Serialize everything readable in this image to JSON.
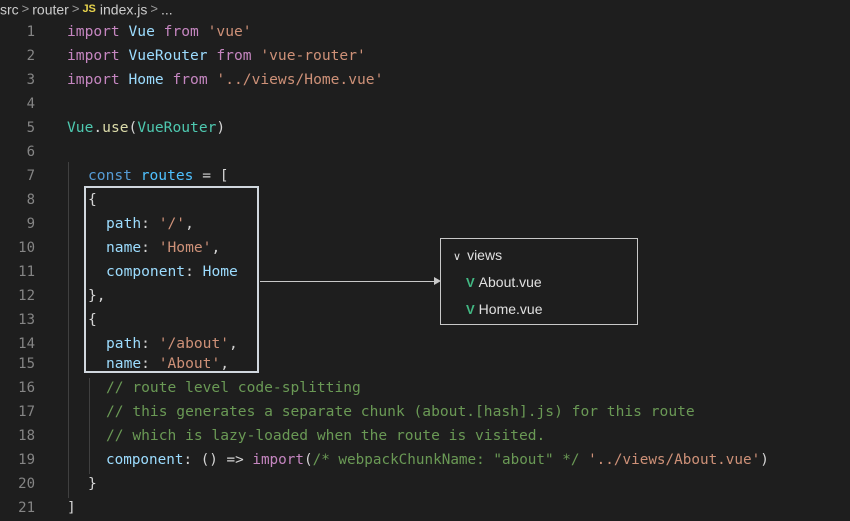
{
  "breadcrumb": {
    "part1": "src",
    "part2": "router",
    "file": "index.js",
    "more": "...",
    "sep": ">",
    "file_badge": "JS"
  },
  "line_numbers": [
    "1",
    "2",
    "3",
    "4",
    "5",
    "6",
    "7",
    "8",
    "9",
    "10",
    "11",
    "12",
    "13",
    "14",
    "15",
    "16",
    "17",
    "18",
    "19",
    "20",
    "21"
  ],
  "code": {
    "l1": {
      "kw": "import",
      "id": "Vue",
      "from": "from",
      "str": "'vue'"
    },
    "l2": {
      "kw": "import",
      "id": "VueRouter",
      "from": "from",
      "str": "'vue-router'"
    },
    "l3": {
      "kw": "import",
      "id": "Home",
      "from": "from",
      "str": "'../views/Home.vue'"
    },
    "l5": {
      "obj": "Vue",
      "dot": ".",
      "fn": "use",
      "open": "(",
      "arg": "VueRouter",
      "close": ")"
    },
    "l7": {
      "kw": "const",
      "id": "routes",
      "rest": " = ["
    },
    "l8": "{",
    "l9": {
      "key": "path",
      "colon": ": ",
      "str": "'/'",
      "comma": ","
    },
    "l10": {
      "key": "name",
      "colon": ": ",
      "str": "'Home'",
      "comma": ","
    },
    "l11": {
      "key": "component",
      "colon": ": ",
      "val": "Home"
    },
    "l12": "},",
    "l13": "{",
    "l14": {
      "key": "path",
      "colon": ": ",
      "str": "'/about'",
      "comma": ","
    },
    "l15": {
      "key": "name",
      "colon": ": ",
      "str": "'About'",
      "comma": ","
    },
    "l16": "// route level code-splitting",
    "l17": "// this generates a separate chunk (about.[hash].js) for this route",
    "l18": "// which is lazy-loaded when the route is visited.",
    "l19": {
      "key": "component",
      "colon": ": ",
      "arrow": "() => ",
      "fn": "import",
      "open": "(",
      "cmt": "/* webpackChunkName: \"about\" */",
      "sp": " ",
      "str": "'../views/About.vue'",
      "close": ")"
    },
    "l20": "}",
    "l21": "]"
  },
  "file_tree": {
    "folder": "views",
    "folder_icon": "chevron-down-icon",
    "items": [
      {
        "label": "About.vue",
        "icon": "vue-icon"
      },
      {
        "label": "Home.vue",
        "icon": "vue-icon"
      }
    ],
    "vue_glyph": "V",
    "chevron_glyph": "∨"
  },
  "colors": {
    "background": "#1e1e1e",
    "keyword_control": "#c586c0",
    "keyword_decl": "#569cd6",
    "variable": "#9cdcfe",
    "class": "#4ec9b0",
    "function": "#dcdcaa",
    "string": "#ce9178",
    "comment": "#6a9955",
    "vue_green": "#42b883"
  }
}
